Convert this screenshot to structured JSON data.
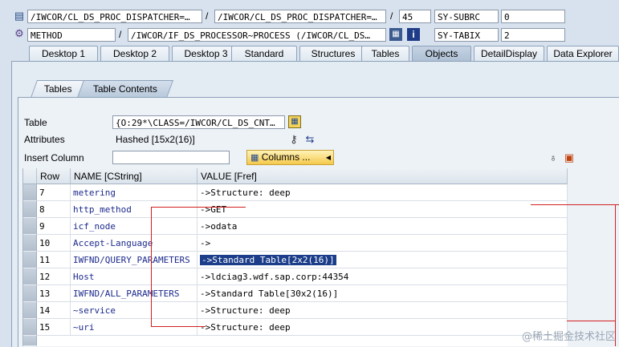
{
  "header": {
    "row1": {
      "field1": "/IWCOR/CL_DS_PROC_DISPATCHER=…",
      "sep1": "/",
      "field2": "/IWCOR/CL_DS_PROC_DISPATCHER=…",
      "sep2": "/",
      "line": "45",
      "var_name": "SY-SUBRC",
      "var_value": "0"
    },
    "row2": {
      "type": "METHOD",
      "sep": "/",
      "method": "/IWCOR/IF_DS_PROCESSOR~PROCESS (/IWCOR/CL_DS…",
      "var_name": "SY-TABIX",
      "var_value": "2"
    }
  },
  "tabs": [
    "Desktop 1",
    "Desktop 2",
    "Desktop 3",
    "Standard",
    "Structures",
    "Tables",
    "Objects",
    "DetailDisplay",
    "Data Explorer"
  ],
  "active_tab": "Objects",
  "subtabs": [
    "Tables",
    "Table Contents"
  ],
  "form": {
    "table_label": "Table",
    "table_value": "{O:29*\\CLASS=/IWCOR/CL_DS_CNT…",
    "attributes_label": "Attributes",
    "attributes_value": "Hashed [15x2(16)]",
    "insert_column_label": "Insert Column",
    "insert_column_value": "",
    "columns_button": "Columns ..."
  },
  "grid": {
    "headers": [
      "Row",
      "NAME [CString]",
      "VALUE [Fref]"
    ],
    "rows": [
      {
        "row": "7",
        "name": "metering",
        "value": "->Structure: deep"
      },
      {
        "row": "8",
        "name": "http_method",
        "value": "->GET"
      },
      {
        "row": "9",
        "name": "icf_node",
        "value": "->odata"
      },
      {
        "row": "10",
        "name": "Accept-Language",
        "value": "->"
      },
      {
        "row": "11",
        "name": "IWFND/QUERY_PARAMETERS",
        "value": "->Standard Table[2x2(16)]"
      },
      {
        "row": "12",
        "name": "Host",
        "value": "->ldciag3.wdf.sap.corp:44354"
      },
      {
        "row": "13",
        "name": "IWFND/ALL_PARAMETERS",
        "value": "->Standard Table[30x2(16)]"
      },
      {
        "row": "14",
        "name": "~service",
        "value": "->Structure: deep"
      },
      {
        "row": "15",
        "name": "~uri",
        "value": "->Structure: deep"
      }
    ]
  },
  "watermark": "@稀土掘金技术社区",
  "colors": {
    "annotation_red": "#d21f1f",
    "selection": "#1b3d8a"
  }
}
